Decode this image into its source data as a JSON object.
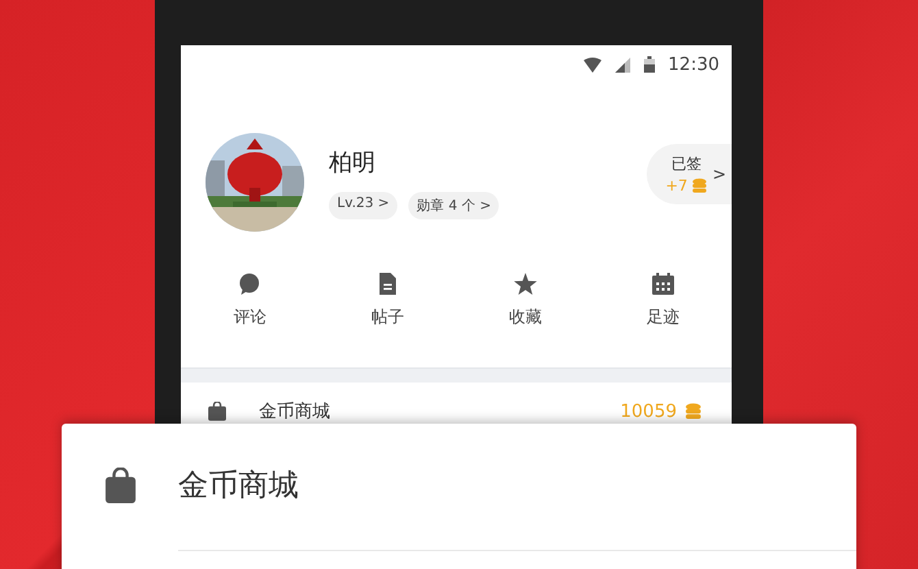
{
  "status_bar": {
    "time": "12:30"
  },
  "profile": {
    "name": "柏明",
    "kind": "picture",
    "chips": [
      "Lv.23 >",
      "勋章 4 个 >"
    ]
  },
  "checkin": {
    "label": "已签",
    "reward": "+7",
    "arrow": ">"
  },
  "shortcuts": [
    {
      "label": "评论"
    },
    {
      "label": "帖子"
    },
    {
      "label": "收藏"
    },
    {
      "label": "足迹"
    }
  ],
  "menu_row": {
    "label": "金币商城",
    "value": "10059"
  },
  "popup_row": {
    "label": "金币商城"
  }
}
